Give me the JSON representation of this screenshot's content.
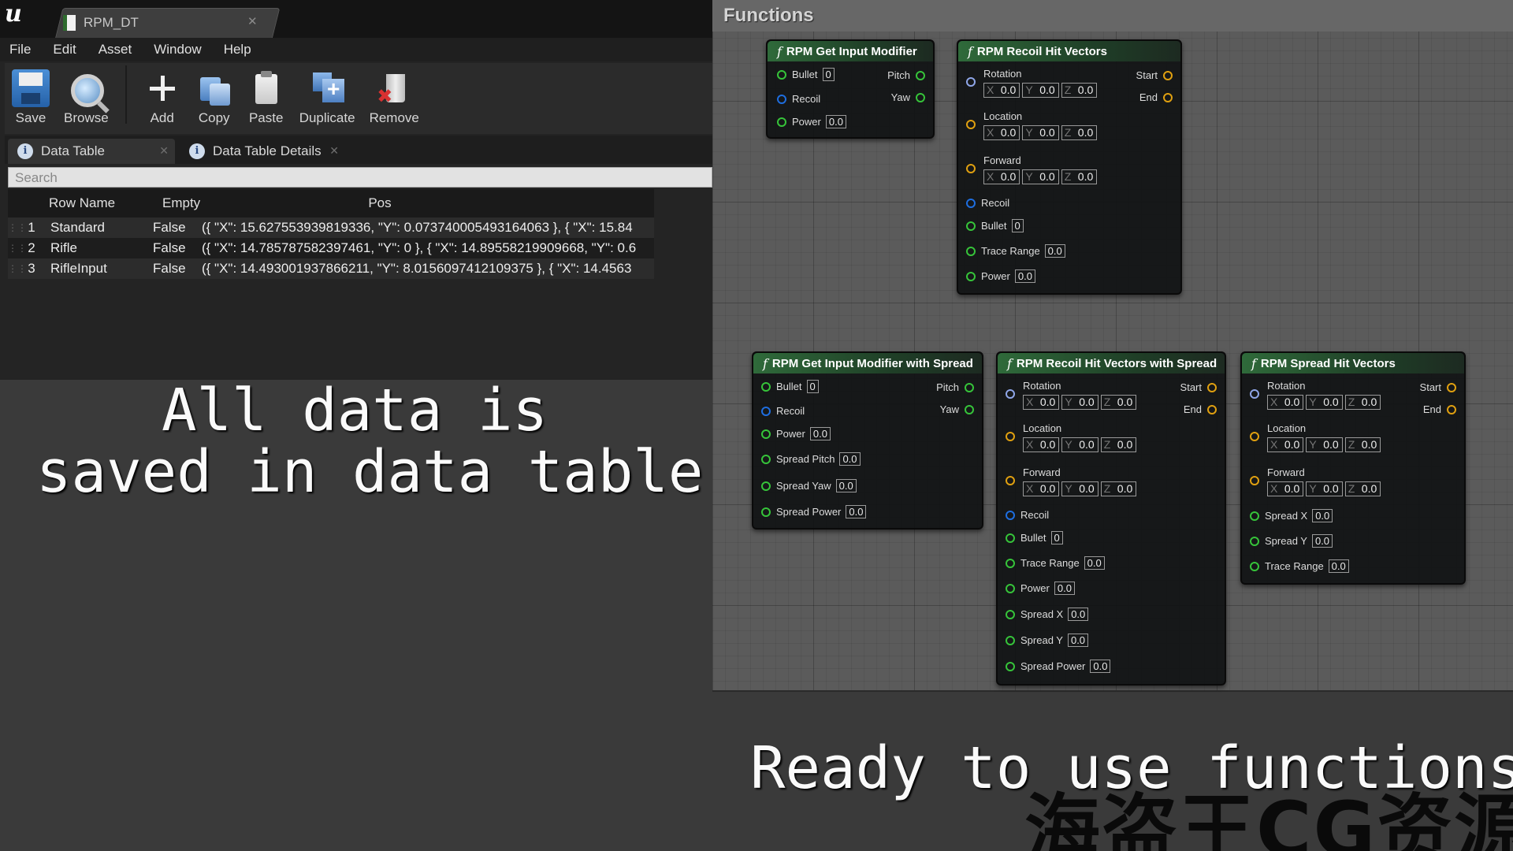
{
  "window": {
    "doc_tab": "RPM_DT"
  },
  "menu": [
    "File",
    "Edit",
    "Asset",
    "Window",
    "Help"
  ],
  "toolbar": {
    "save": "Save",
    "browse": "Browse",
    "add": "Add",
    "copy": "Copy",
    "paste": "Paste",
    "duplicate": "Duplicate",
    "remove": "Remove"
  },
  "panel_tabs": {
    "data_table": "Data Table",
    "details": "Data Table Details"
  },
  "search": {
    "placeholder": "Search"
  },
  "table": {
    "headers": {
      "row_name": "Row Name",
      "empty": "Empty",
      "pos": "Pos"
    },
    "rows": [
      {
        "idx": "1",
        "name": "Standard",
        "empty": "False",
        "pos": "({ \"X\": 15.627553939819336, \"Y\": 0.073740005493164063 }, { \"X\": 15.84"
      },
      {
        "idx": "2",
        "name": "Rifle",
        "empty": "False",
        "pos": "({ \"X\": 14.785787582397461, \"Y\": 0 }, { \"X\": 14.89558219909668, \"Y\": 0.6"
      },
      {
        "idx": "3",
        "name": "RifleInput",
        "empty": "False",
        "pos": "({ \"X\": 14.493001937866211, \"Y\": 8.0156097412109375 }, { \"X\": 14.4563"
      }
    ]
  },
  "captions": {
    "left_line1": "All data is",
    "left_line2": "saved in data table.",
    "right": "Ready to use functions",
    "watermark": "海盗王CG资源"
  },
  "functions": {
    "title": "Functions",
    "node1": {
      "title": "RPM Get Input Modifier",
      "bullet": "Bullet",
      "bullet_val": "0",
      "recoil": "Recoil",
      "power": "Power",
      "power_val": "0.0",
      "pitch": "Pitch",
      "yaw": "Yaw"
    },
    "node2": {
      "title": "RPM Recoil Hit Vectors",
      "rotation": "Rotation",
      "location": "Location",
      "forward": "Forward",
      "recoil": "Recoil",
      "bullet": "Bullet",
      "bullet_val": "0",
      "trace_range": "Trace Range",
      "trace_val": "0.0",
      "power": "Power",
      "power_val": "0.0",
      "start": "Start",
      "end": "End"
    },
    "node3": {
      "title": "RPM Get Input Modifier with Spread",
      "bullet": "Bullet",
      "bullet_val": "0",
      "recoil": "Recoil",
      "power": "Power",
      "power_val": "0.0",
      "spread_pitch": "Spread Pitch",
      "sp_val": "0.0",
      "spread_yaw": "Spread Yaw",
      "sy_val": "0.0",
      "spread_power": "Spread Power",
      "spw_val": "0.0",
      "pitch": "Pitch",
      "yaw": "Yaw"
    },
    "node4": {
      "title": "RPM Recoil Hit Vectors with Spread",
      "rotation": "Rotation",
      "location": "Location",
      "forward": "Forward",
      "recoil": "Recoil",
      "bullet": "Bullet",
      "bullet_val": "0",
      "trace_range": "Trace Range",
      "trace_val": "0.0",
      "power": "Power",
      "power_val": "0.0",
      "spread_x": "Spread X",
      "sx_val": "0.0",
      "spread_y": "Spread Y",
      "sy_val": "0.0",
      "spread_power": "Spread Power",
      "spw_val": "0.0",
      "start": "Start",
      "end": "End"
    },
    "node5": {
      "title": "RPM Spread Hit Vectors",
      "rotation": "Rotation",
      "location": "Location",
      "forward": "Forward",
      "spread_x": "Spread X",
      "sx_val": "0.0",
      "spread_y": "Spread Y",
      "sy_val": "0.0",
      "trace_range": "Trace Range",
      "trace_val": "0.0",
      "start": "Start",
      "end": "End"
    },
    "vector": {
      "x": "X",
      "y": "Y",
      "z": "Z",
      "zero": "0.0"
    }
  }
}
